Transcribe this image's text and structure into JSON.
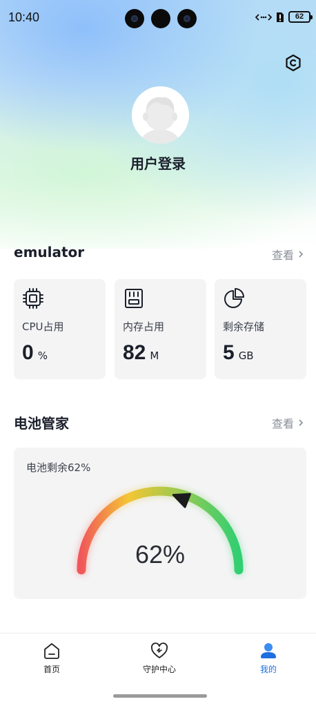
{
  "status_bar": {
    "time": "10:40",
    "battery_level": "62"
  },
  "header": {
    "login_label": "用户登录"
  },
  "device": {
    "name": "emulator",
    "view_more": "查看",
    "stats": [
      {
        "label": "CPU占用",
        "value": "0",
        "unit": "%",
        "icon": "cpu-chip-icon"
      },
      {
        "label": "内存占用",
        "value": "82",
        "unit": "M",
        "icon": "memory-card-icon"
      },
      {
        "label": "剩余存储",
        "value": "5",
        "unit": "GB",
        "icon": "pie-chart-icon"
      }
    ]
  },
  "battery_section": {
    "title": "电池管家",
    "view_more": "查看",
    "caption": "电池剩余62%",
    "percent_text": "62%",
    "percent": 62
  },
  "tabs": [
    {
      "label": "首页",
      "icon": "home-icon",
      "active": false
    },
    {
      "label": "守护中心",
      "icon": "heart-shield-icon",
      "active": false
    },
    {
      "label": "我的",
      "icon": "user-icon",
      "active": true
    }
  ],
  "colors": {
    "accent": "#1f6fe0",
    "gauge_start": "#f0575b",
    "gauge_mid": "#f5c534",
    "gauge_end": "#2fcf72"
  }
}
